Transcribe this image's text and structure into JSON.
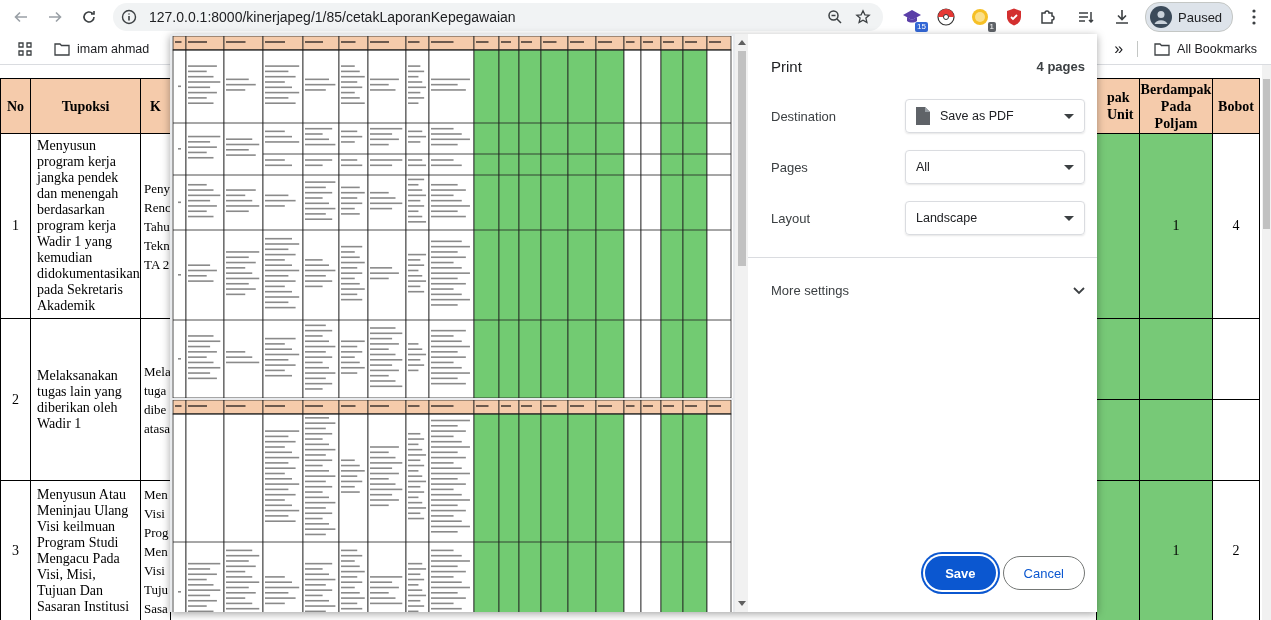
{
  "browser": {
    "url": "127.0.0.1:8000/kinerjapeg/1/85/cetakLaporanKepegawaian",
    "extensions": [
      {
        "kind": "hat",
        "badge": "15"
      },
      {
        "kind": "ball"
      },
      {
        "kind": "coin",
        "badge": "1"
      },
      {
        "kind": "shield"
      },
      {
        "kind": "puzzle"
      }
    ],
    "profile": "Paused"
  },
  "bookmarks": {
    "items": [
      "imam ahmad"
    ],
    "overflow": "»",
    "all": "All Bookmarks"
  },
  "page": {
    "left_columns": [
      "No",
      "Tupoksi",
      "K"
    ],
    "left_rows": [
      {
        "no": "1",
        "tupoksi": "Menyusun program kerja jangka pendek dan menengah berdasarkan program kerja Wadir 1 yang kemudian didokumentasikan pada Sekretaris Akademik",
        "kegiatan_lines": [
          "Peny",
          "Renc",
          "Tahu",
          "Tekn",
          "TA 2"
        ]
      },
      {
        "no": "2",
        "tupoksi": "Melaksanakan tugas lain yang diberikan oleh Wadir 1",
        "kegiatan_lines": [
          "Mela",
          "tuga",
          "dibe",
          "atasa"
        ]
      },
      {
        "no": "3",
        "tupoksi": "Menyusun Atau Meninjau Ulang Visi keilmuan Program Studi Mengacu Pada Visi, Misi, Tujuan Dan Sasaran Institusi",
        "kegiatan_lines": [
          "Men",
          "Visi",
          "Prog",
          "Men",
          "Visi",
          "Tuju",
          "Sasa"
        ]
      }
    ],
    "right_columns": [
      {
        "label": "pak Unit",
        "shaded": true
      },
      {
        "label": "Berdampak Pada Poljam",
        "shaded": true
      },
      {
        "label": "Bobot",
        "shaded": false
      }
    ],
    "right_rows": [
      {
        "split": false,
        "poljam": "1",
        "bobot": "4"
      },
      {
        "split": true
      },
      {
        "split": false,
        "poljam": "1",
        "bobot": "2"
      }
    ]
  },
  "print_dialog": {
    "title": "Print",
    "page_count": "4 pages",
    "settings": [
      {
        "label": "Destination",
        "value": "Save as PDF",
        "kind": "file"
      },
      {
        "label": "Pages",
        "value": "All",
        "kind": "plain"
      },
      {
        "label": "Layout",
        "value": "Landscape",
        "kind": "plain"
      }
    ],
    "more_settings": "More settings",
    "buttons": [
      {
        "label": "Save",
        "kind": "primary"
      },
      {
        "label": "Cancel",
        "kind": "secondary"
      }
    ],
    "preview": {
      "columns": [
        {
          "shaded": false
        },
        {
          "shaded": false
        },
        {
          "shaded": false
        },
        {
          "shaded": false
        },
        {
          "shaded": false
        },
        {
          "shaded": false
        },
        {
          "shaded": false
        },
        {
          "shaded": false
        },
        {
          "shaded": false
        },
        {
          "shaded": true
        },
        {
          "shaded": true
        },
        {
          "shaded": true
        },
        {
          "shaded": true
        },
        {
          "shaded": true
        },
        {
          "shaded": true
        },
        {
          "shaded": false
        },
        {
          "shaded": false
        },
        {
          "shaded": true
        },
        {
          "shaded": true
        },
        {
          "shaded": false
        }
      ]
    }
  }
}
